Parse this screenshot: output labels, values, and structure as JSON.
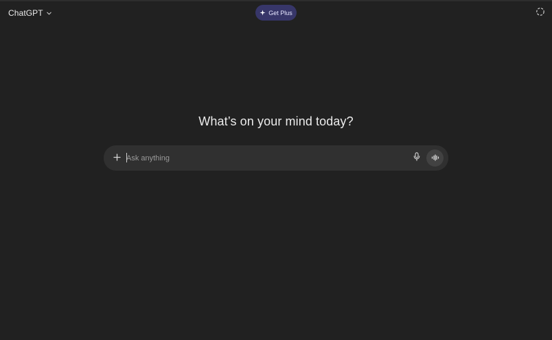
{
  "header": {
    "model_name": "ChatGPT",
    "model_menu_icon": "chevron-down-icon",
    "upgrade_label": "Get Plus",
    "upgrade_icon": "sparkle-icon",
    "temporary_chat_icon": "temporary-chat-icon"
  },
  "main": {
    "headline": "What’s on your mind today?"
  },
  "composer": {
    "placeholder": "Ask anything",
    "value": "",
    "add_icon": "plus-icon",
    "dictate_icon": "microphone-icon",
    "voice_icon": "voice-mode-icon"
  },
  "colors": {
    "background": "#212121",
    "composer": "#303030",
    "upgrade_pill": "#373669",
    "voice_button": "#424242",
    "text": "#ececec",
    "placeholder": "#9a9a9a"
  }
}
